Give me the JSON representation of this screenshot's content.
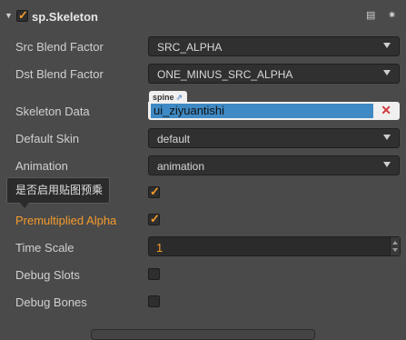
{
  "component": {
    "title": "sp.Skeleton",
    "enabled": true
  },
  "fields": {
    "src_blend": {
      "label": "Src Blend Factor",
      "value": "SRC_ALPHA"
    },
    "dst_blend": {
      "label": "Dst Blend Factor",
      "value": "ONE_MINUS_SRC_ALPHA"
    },
    "skeleton_data": {
      "label": "Skeleton Data",
      "asset_type": "spine",
      "value": "ui_ziyuantishi"
    },
    "default_skin": {
      "label": "Default Skin",
      "value": "default"
    },
    "animation": {
      "label": "Animation",
      "value": "animation"
    },
    "loop": {
      "checked": true
    },
    "premultiplied_alpha": {
      "label": "Premultiplied Alpha",
      "checked": true
    },
    "time_scale": {
      "label": "Time Scale",
      "value": "1"
    },
    "debug_slots": {
      "label": "Debug Slots",
      "checked": false
    },
    "debug_bones": {
      "label": "Debug Bones",
      "checked": false
    }
  },
  "tooltip": {
    "text": "是否启用贴图预乘"
  },
  "colors": {
    "accent": "#f39b2c",
    "selection": "#3f8ac4",
    "clear": "#d23a3a"
  }
}
